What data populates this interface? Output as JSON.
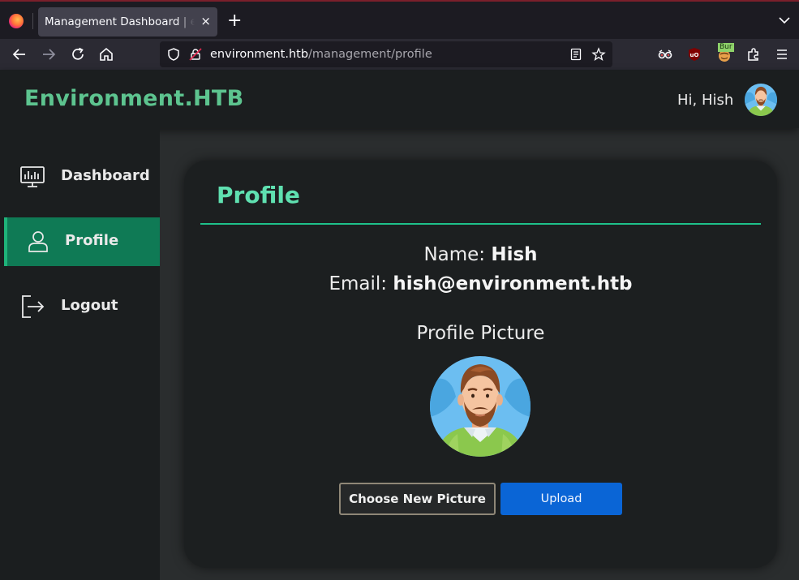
{
  "browser": {
    "tab_title": "Management Dashboard | environment.htb",
    "tab_close": "×",
    "new_tab": "+",
    "url_host": "environment.htb",
    "url_path": "/management/profile",
    "extensions": [
      "extension-glasses-icon",
      "ublock-icon",
      "burp-icon",
      "extensions-puzzle-icon"
    ],
    "burp_badge": "Bur"
  },
  "header": {
    "brand": "Environment.HTB",
    "greeting": "Hi, Hish"
  },
  "sidebar": {
    "items": [
      {
        "label": "Dashboard",
        "icon": "monitor-chart-icon",
        "active": false
      },
      {
        "label": "Profile",
        "icon": "user-icon",
        "active": true
      },
      {
        "label": "Logout",
        "icon": "logout-icon",
        "active": false
      }
    ]
  },
  "profile": {
    "title": "Profile",
    "name_label": "Name:",
    "name_value": "Hish",
    "email_label": "Email:",
    "email_value": "hish@environment.htb",
    "picture_label": "Profile Picture",
    "choose_button": "Choose New Picture",
    "upload_button": "Upload"
  },
  "colors": {
    "brand": "#5dc48f",
    "accent": "#1ec08a",
    "active_nav": "#0f7a55",
    "upload": "#0a65d6"
  }
}
